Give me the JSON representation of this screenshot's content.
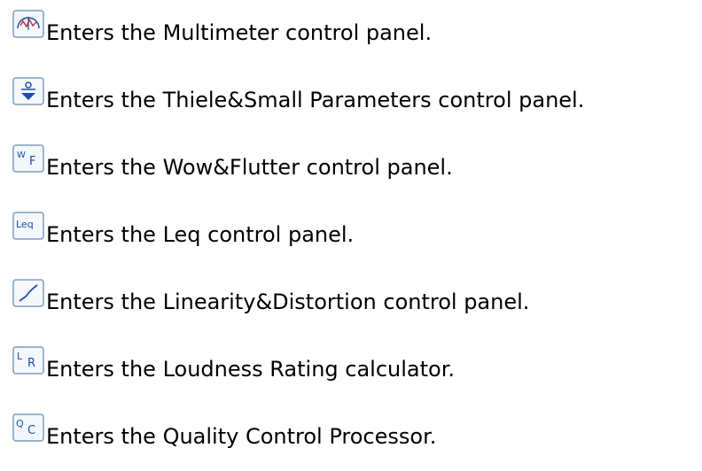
{
  "items": [
    {
      "icon": "multimeter-icon",
      "text": "Enters the Multimeter control panel."
    },
    {
      "icon": "thiele-small-icon",
      "text": "Enters the Thiele&Small Parameters control panel."
    },
    {
      "icon": "wow-flutter-icon",
      "icon_label": "WF",
      "text": "Enters the Wow&Flutter control panel."
    },
    {
      "icon": "leq-icon",
      "icon_label": "Leq",
      "text": "Enters the Leq control panel."
    },
    {
      "icon": "linearity-distortion-icon",
      "text": "Enters the Linearity&Distortion control panel."
    },
    {
      "icon": "loudness-rating-icon",
      "icon_label": "LR",
      "text": "Enters the Loudness Rating calculator."
    },
    {
      "icon": "quality-control-icon",
      "icon_label": "QC",
      "text": "Enters the Quality Control Processor."
    }
  ],
  "colors": {
    "icon_border": "#7f9db9",
    "icon_fill": "#f4f8fc",
    "icon_glyph": "#1c4ea6",
    "text": "#000000"
  }
}
